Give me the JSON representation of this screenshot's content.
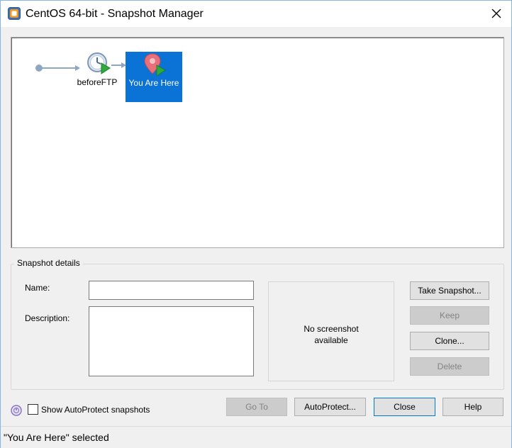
{
  "window": {
    "title": "CentOS 64-bit - Snapshot Manager",
    "app_icon": "vmware-workstation-icon",
    "close_icon": "close-icon"
  },
  "tree": {
    "root_icon": "root-node-dot-icon",
    "snapshots": [
      {
        "label": "beforeFTP",
        "icon": "clock-snapshot-icon"
      }
    ],
    "current": {
      "label": "You Are Here",
      "icon": "location-pin-icon",
      "selected": true
    },
    "colors": {
      "selection": "#0b72d6",
      "connector": "#8ea6c2"
    }
  },
  "details": {
    "group_title": "Snapshot details",
    "name_label": "Name:",
    "name_value": "",
    "description_label": "Description:",
    "description_value": "",
    "preview_text_line1": "No screenshot",
    "preview_text_line2": "available"
  },
  "side_buttons": {
    "take_snapshot": "Take Snapshot...",
    "keep": "Keep",
    "clone": "Clone...",
    "delete": "Delete"
  },
  "bottom": {
    "autoprotect_icon": "autoprotect-clock-icon",
    "show_autoprotect_label": "Show AutoProtect snapshots",
    "show_autoprotect_checked": false,
    "goto": "Go To",
    "autoprotect": "AutoProtect...",
    "close": "Close",
    "help": "Help"
  },
  "status": {
    "text": "\"You Are Here\" selected"
  }
}
